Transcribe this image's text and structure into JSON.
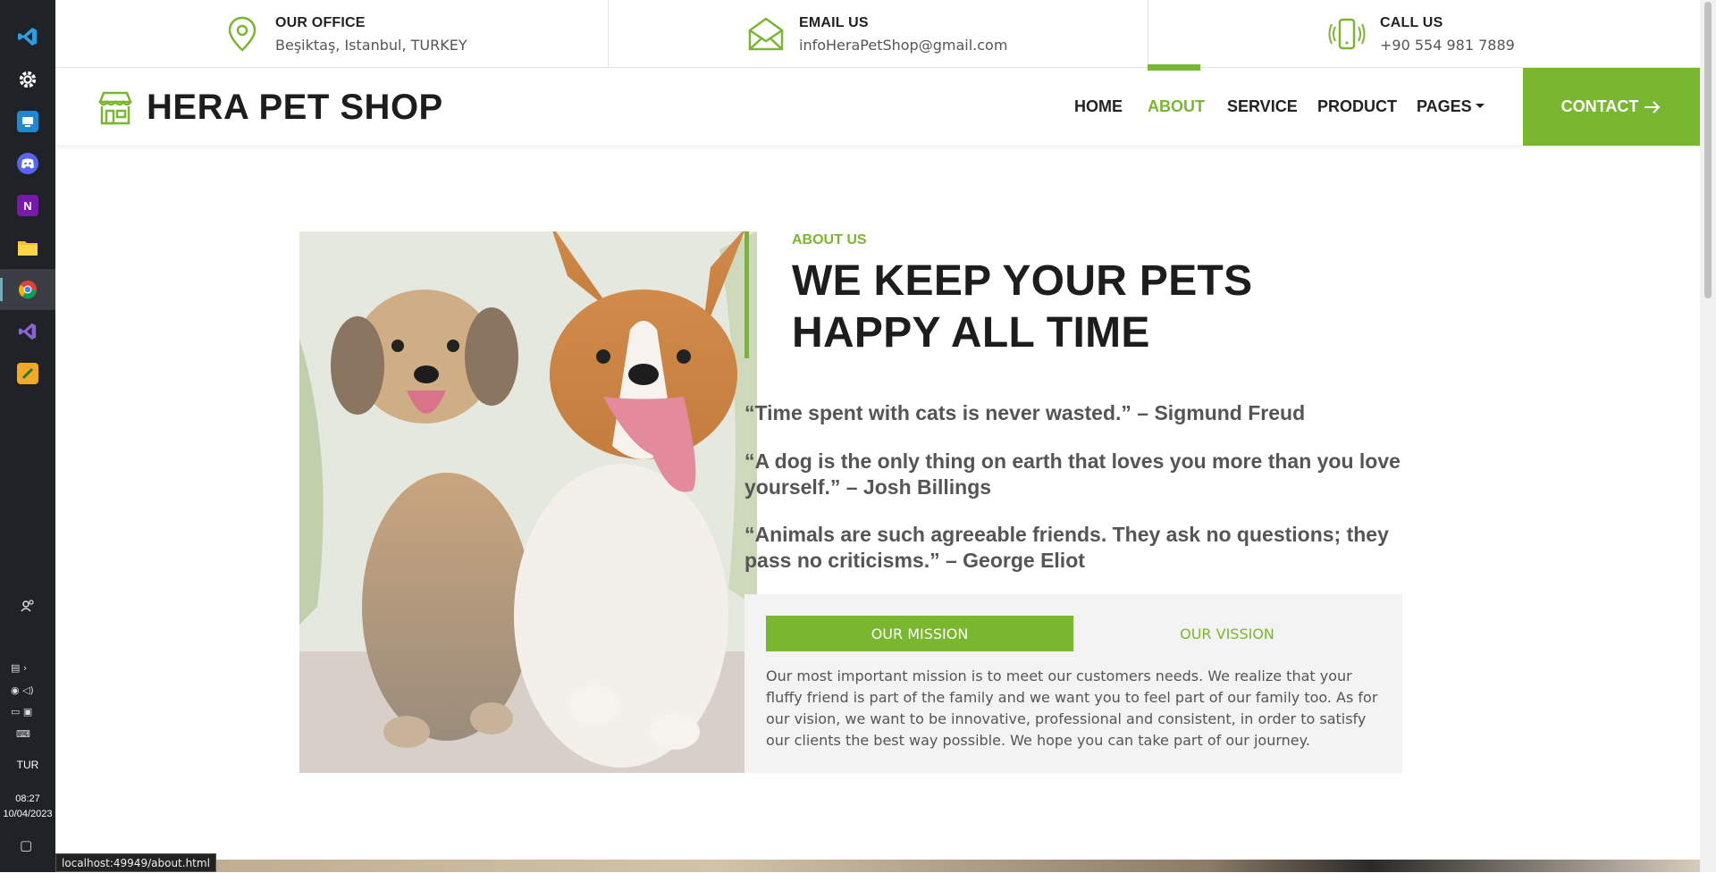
{
  "taskbar": {
    "language": "TUR",
    "time": "08:27",
    "date": "10/04/2023"
  },
  "topbar": {
    "office": {
      "title": "OUR OFFICE",
      "value": "Beşiktaş, Istanbul, TURKEY",
      "icon": "map-pin-icon"
    },
    "email": {
      "title": "EMAIL US",
      "value": "infoHeraPetShop@gmail.com",
      "icon": "envelope-icon"
    },
    "call": {
      "title": "CALL US",
      "value": "+90 554 981 7889",
      "icon": "phone-icon"
    }
  },
  "nav": {
    "brand": "HERA PET SHOP",
    "items": [
      "HOME",
      "ABOUT",
      "SERVICE",
      "PRODUCT",
      "PAGES"
    ],
    "active": "ABOUT",
    "contact": "CONTACT"
  },
  "about": {
    "eyebrow": "ABOUT US",
    "headline": "WE KEEP YOUR PETS HAPPY ALL TIME",
    "quotes": [
      "“Time spent with cats is never wasted.” – Sigmund Freud",
      "“A dog is the only thing on earth that loves you more than you love yourself.” – Josh Billings",
      "“Animals are such agreeable friends. They ask no questions; they pass no criticisms.” – George Eliot"
    ],
    "tabs": [
      "OUR MISSION",
      "OUR VISSION"
    ],
    "tab_text": "Our most important mission is to meet our customers needs. We realize that your fluffy friend is part of the family and we want you to feel part of our family too. As for our vision, we want to be innovative, professional and consistent, in order to satisfy our clients the best way possible. We hope you can take part of our journey."
  },
  "status_url": "localhost:49949/about.html",
  "colors": {
    "accent": "#7ab730",
    "dark": "#1d1d1d",
    "taskbar": "#1f2226"
  }
}
